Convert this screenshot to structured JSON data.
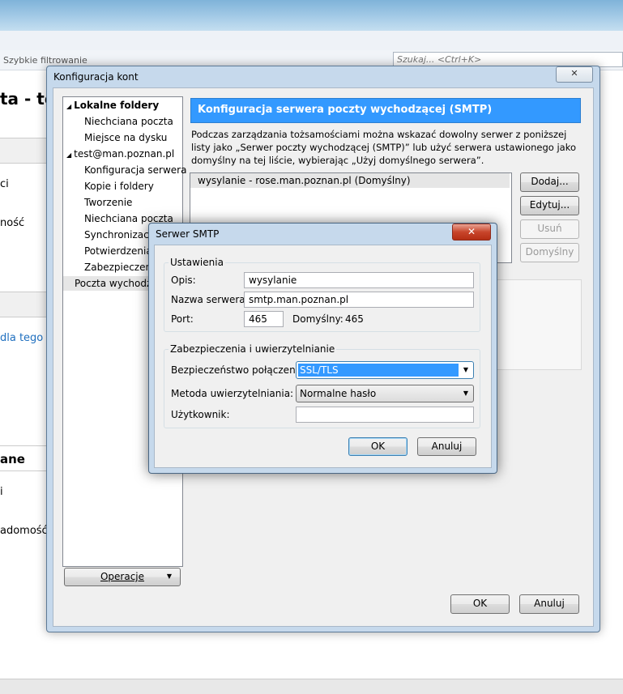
{
  "background": {
    "filter_label": "Szybkie filtrowanie",
    "search_placeholder": "Szukaj... <Ctrl+K>",
    "heading": "ta - te",
    "line1": "ci",
    "line2": "ność",
    "link": "dla tego",
    "heading2": "ane",
    "line3": "i",
    "line4": "adomość"
  },
  "main_dialog": {
    "title": "Konfiguracja kont",
    "close_glyph": "✕",
    "tree": [
      {
        "label": "Lokalne foldery",
        "level": 0,
        "expanded": true,
        "bold": true
      },
      {
        "label": "Niechciana poczta",
        "level": 1
      },
      {
        "label": "Miejsce na dysku",
        "level": 1
      },
      {
        "label": "test@man.poznan.pl",
        "level": 0,
        "expanded": true
      },
      {
        "label": "Konfiguracja serwera",
        "level": 1
      },
      {
        "label": "Kopie i foldery",
        "level": 1
      },
      {
        "label": "Tworzenie",
        "level": 1
      },
      {
        "label": "Niechciana poczta",
        "level": 1
      },
      {
        "label": "Synchronizacja",
        "level": 1
      },
      {
        "label": "Potwierdzenia",
        "level": 1
      },
      {
        "label": "Zabezpieczenia",
        "level": 1
      },
      {
        "label": "Poczta wychodząca",
        "level": 0,
        "selected": true
      }
    ],
    "operations_button": "Operacje",
    "panel_title": "Konfiguracja serwera poczty wychodzącej (SMTP)",
    "panel_description": "Podczas zarządzania tożsamościami można wskazać dowolny serwer z poniższej listy jako „Serwer poczty wychodzącej (SMTP)” lub użyć serwera ustawionego jako domyślny na tej liście, wybierając „Użyj domyślnego serwera”.",
    "servers": [
      "wysylanie - rose.man.poznan.pl (Domyślny)"
    ],
    "buttons": {
      "add": "Dodaj...",
      "edit": "Edytuj...",
      "remove": "Usuń",
      "default": "Domyślny"
    },
    "ok": "OK",
    "cancel": "Anuluj"
  },
  "smtp_dialog": {
    "title": "Serwer SMTP",
    "close_glyph": "✕",
    "settings_group": "Ustawienia",
    "description_label": "Opis:",
    "description_value": "wysylanie",
    "server_label": "Nazwa serwera:",
    "server_value": "smtp.man.poznan.pl",
    "port_label": "Port:",
    "port_value": "465",
    "default_port_label": "Domyślny:",
    "default_port_value": "465",
    "security_group": "Zabezpieczenia i uwierzytelnianie",
    "connection_security_label": "Bezpieczeństwo połączenia:",
    "connection_security_value": "SSL/TLS",
    "auth_method_label": "Metoda uwierzytelniania:",
    "auth_method_value": "Normalne hasło",
    "username_label": "Użytkownik:",
    "username_value": "",
    "ok": "OK",
    "cancel": "Anuluj"
  }
}
